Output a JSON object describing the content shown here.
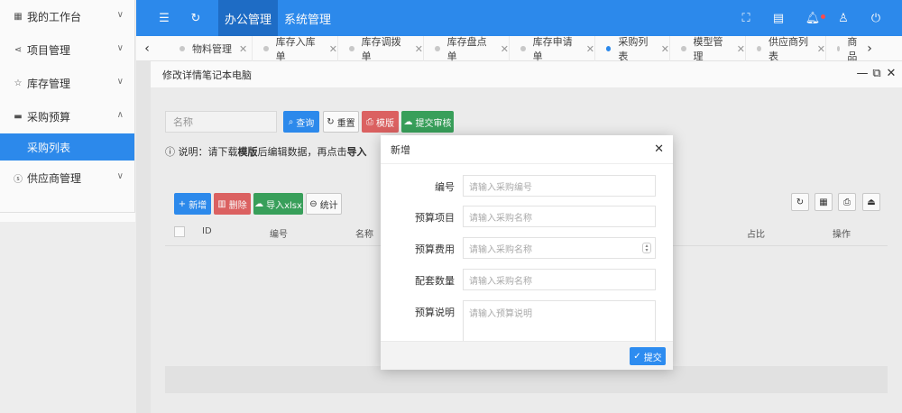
{
  "sidebar": {
    "items": [
      {
        "label": "我的工作台",
        "icon": "grid-icon"
      },
      {
        "label": "项目管理",
        "icon": "share-icon"
      },
      {
        "label": "库存管理",
        "icon": "star-icon"
      },
      {
        "label": "采购预算",
        "icon": "printer-icon"
      },
      {
        "label": "供应商管理",
        "icon": "dollar-circle-icon"
      }
    ],
    "active_sub": "采购列表"
  },
  "header": {
    "nav": [
      "办公管理",
      "系统管理"
    ],
    "active_nav": "办公管理",
    "accent_color": "#2d8cf0"
  },
  "tabs": {
    "items": [
      "物料管理",
      "库存入库单",
      "库存调拨单",
      "库存盘点单",
      "库存申请单",
      "采购列表",
      "模型管理",
      "供应商列表",
      "商品"
    ],
    "active": "采购列表"
  },
  "window": {
    "title": "修改详情笔记本电脑"
  },
  "toolbar": {
    "search_placeholder": "名称",
    "query": "查询",
    "reset": "重置",
    "template": "模版",
    "submit_review": "提交审核"
  },
  "notice": {
    "prefix": "说明：请下载",
    "bold1": "模版",
    "middle": "后编辑数据，再点击",
    "bold2": "导入"
  },
  "actions": {
    "add": "新增",
    "delete": "删除",
    "import": "导入xlsx",
    "stats": "统计"
  },
  "table": {
    "columns": [
      "ID",
      "编号",
      "名称",
      "占比",
      "操作"
    ]
  },
  "modal": {
    "title": "新增",
    "fields": [
      {
        "label": "编号",
        "placeholder": "请输入采购编号"
      },
      {
        "label": "预算项目",
        "placeholder": "请输入采购名称"
      },
      {
        "label": "预算费用",
        "placeholder": "请输入采购名称"
      },
      {
        "label": "配套数量",
        "placeholder": "请输入采购名称"
      },
      {
        "label": "预算说明",
        "placeholder": "请输入预算说明"
      }
    ],
    "submit": "提交"
  }
}
